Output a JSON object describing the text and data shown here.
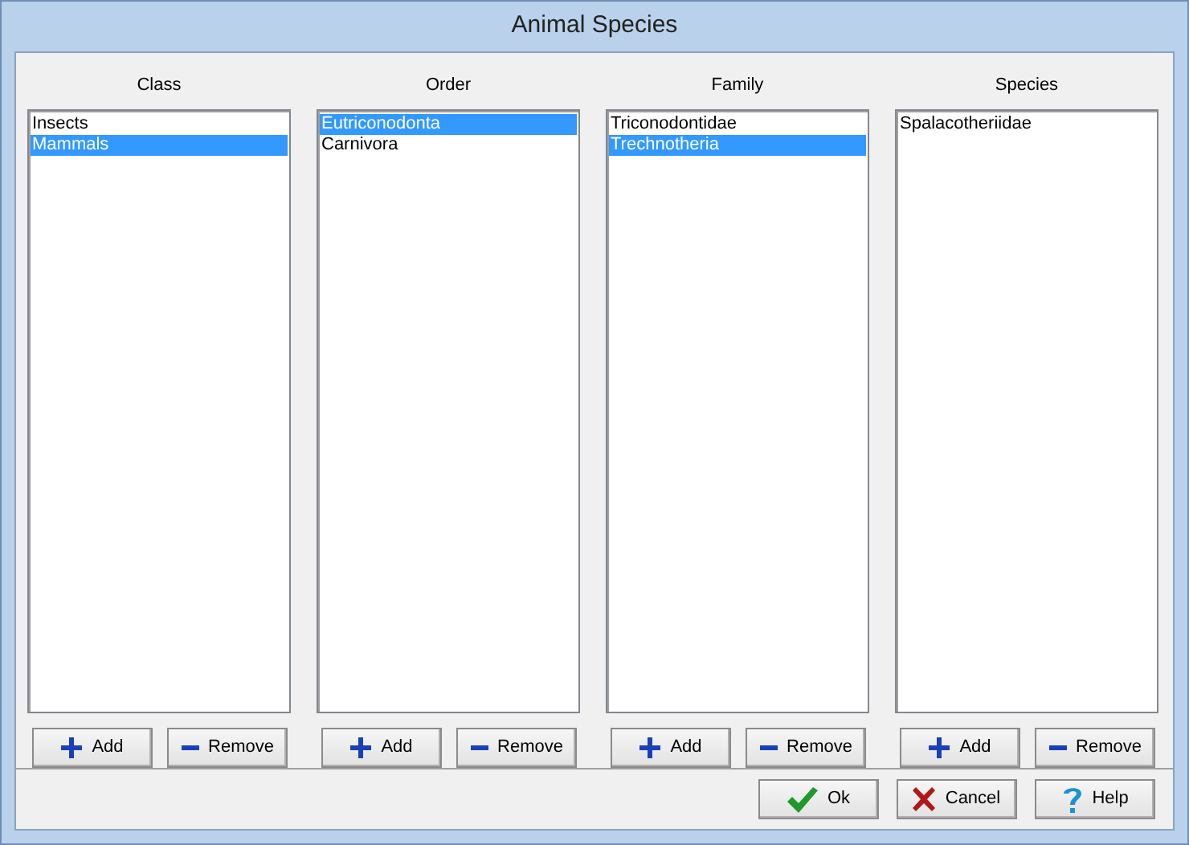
{
  "window": {
    "title": "Animal Species"
  },
  "columns": [
    {
      "heading": "Class",
      "items": [
        {
          "label": "Insects",
          "selected": false
        },
        {
          "label": "Mammals",
          "selected": true
        }
      ],
      "buttons": [
        {
          "kind": "add",
          "label": "Add"
        },
        {
          "kind": "remove",
          "label": "Remove"
        }
      ]
    },
    {
      "heading": "Order",
      "items": [
        {
          "label": "Eutriconodonta",
          "selected": true
        },
        {
          "label": "Carnivora",
          "selected": false
        }
      ],
      "buttons": [
        {
          "kind": "add",
          "label": "Add"
        },
        {
          "kind": "remove",
          "label": "Remove"
        }
      ]
    },
    {
      "heading": "Family",
      "items": [
        {
          "label": "Triconodontidae",
          "selected": false
        },
        {
          "label": "Trechnotheria",
          "selected": true
        }
      ],
      "buttons": [
        {
          "kind": "add",
          "label": "Add"
        },
        {
          "kind": "remove",
          "label": "Remove"
        }
      ]
    },
    {
      "heading": "Species",
      "items": [
        {
          "label": "Spalacotheriidae",
          "selected": false
        }
      ],
      "buttons": [
        {
          "kind": "add",
          "label": "Add"
        },
        {
          "kind": "remove",
          "label": "Remove"
        }
      ]
    }
  ],
  "footer_buttons": [
    {
      "kind": "ok",
      "label": "Ok"
    },
    {
      "kind": "cancel",
      "label": "Cancel"
    },
    {
      "kind": "help",
      "label": "Help"
    }
  ]
}
